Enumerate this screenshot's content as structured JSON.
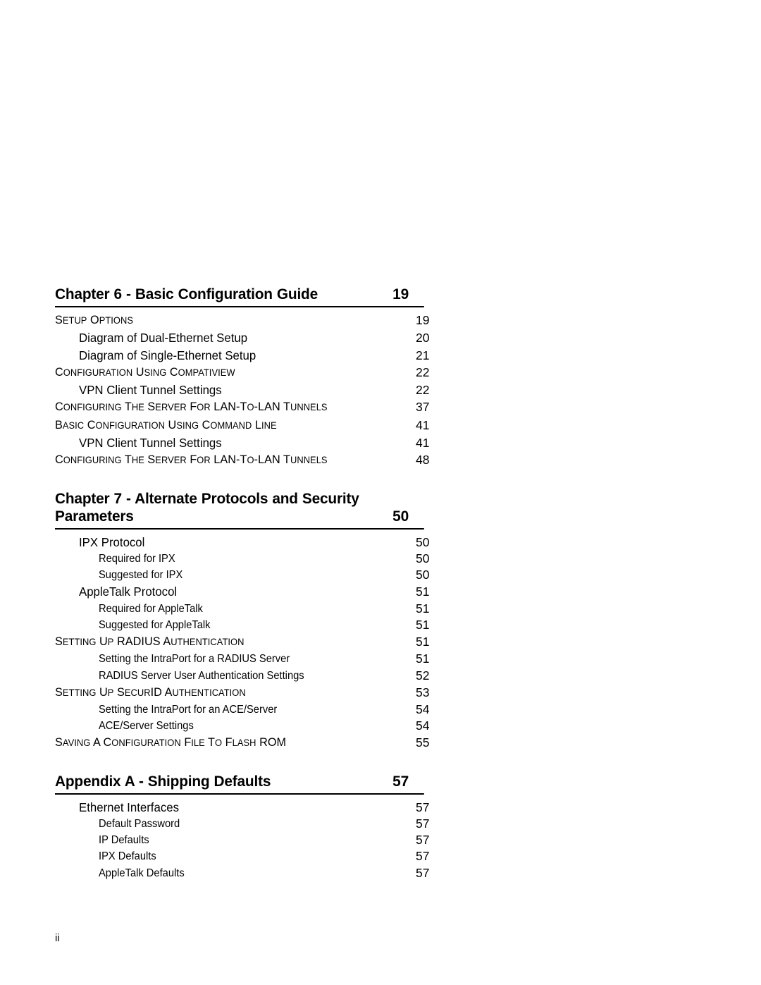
{
  "document": {
    "type": "table-of-contents",
    "footer_page_label": "ii"
  },
  "sections": [
    {
      "heading": "Chapter 6 - Basic Configuration Guide",
      "heading_page": "19",
      "entries": [
        {
          "level": 1,
          "text": "SETUP OPTIONS",
          "page": "19",
          "caps_runs": [
            "S",
            "ETUP ",
            "O",
            "PTIONS"
          ]
        },
        {
          "level": 2,
          "text": "Diagram of Dual-Ethernet Setup",
          "page": "20"
        },
        {
          "level": 2,
          "text": "Diagram of Single-Ethernet Setup",
          "page": "21"
        },
        {
          "level": 1,
          "text": "CONFIGURATION USING COMPATIVIEW",
          "page": "22"
        },
        {
          "level": 2,
          "text": "VPN Client Tunnel Settings",
          "page": "22"
        },
        {
          "level": 1,
          "text": "CONFIGURING THE SERVER FOR LAN-TO-LAN TUNNELS",
          "page": "37"
        },
        {
          "level": 1,
          "text": "BASIC CONFIGURATION USING COMMAND LINE",
          "page": "41"
        },
        {
          "level": 2,
          "text": "VPN Client Tunnel Settings",
          "page": "41"
        },
        {
          "level": 1,
          "text": "CONFIGURING THE SERVER FOR LAN-TO-LAN TUNNELS",
          "page": "48"
        }
      ]
    },
    {
      "heading": "Chapter 7 -  Alternate Protocols and Security Parameters",
      "heading_page": "50",
      "entries": [
        {
          "level": 2,
          "text": "IPX Protocol",
          "page": "50"
        },
        {
          "level": 3,
          "text": "Required for IPX",
          "page": "50"
        },
        {
          "level": 3,
          "text": "Suggested for IPX",
          "page": "50"
        },
        {
          "level": 2,
          "text": "AppleTalk Protocol",
          "page": "51"
        },
        {
          "level": 3,
          "text": "Required for AppleTalk",
          "page": "51"
        },
        {
          "level": 3,
          "text": "Suggested for AppleTalk",
          "page": "51"
        },
        {
          "level": 1,
          "text": "SETTING UP RADIUS AUTHENTICATION",
          "page": "51"
        },
        {
          "level": 3,
          "text": "Setting the IntraPort for a RADIUS Server",
          "page": "51"
        },
        {
          "level": 3,
          "text": "RADIUS Server User Authentication Settings",
          "page": "52"
        },
        {
          "level": 1,
          "text": "SETTING UP SECURID AUTHENTICATION",
          "page": "53"
        },
        {
          "level": 3,
          "text": "Setting the IntraPort for an ACE/Server",
          "page": "54"
        },
        {
          "level": 3,
          "text": "ACE/Server Settings",
          "page": "54"
        },
        {
          "level": 1,
          "text": "SAVING A CONFIGURATION FILE TO FLASH ROM",
          "page": "55"
        }
      ]
    },
    {
      "heading": "Appendix A - Shipping Defaults",
      "heading_page": "57",
      "entries": [
        {
          "level": 2,
          "text": "Ethernet Interfaces",
          "page": "57"
        },
        {
          "level": 3,
          "text": "Default Password",
          "page": "57"
        },
        {
          "level": 3,
          "text": "IP Defaults",
          "page": "57"
        },
        {
          "level": 3,
          "text": "IPX Defaults",
          "page": "57"
        },
        {
          "level": 3,
          "text": "AppleTalk Defaults",
          "page": "57"
        }
      ]
    }
  ]
}
